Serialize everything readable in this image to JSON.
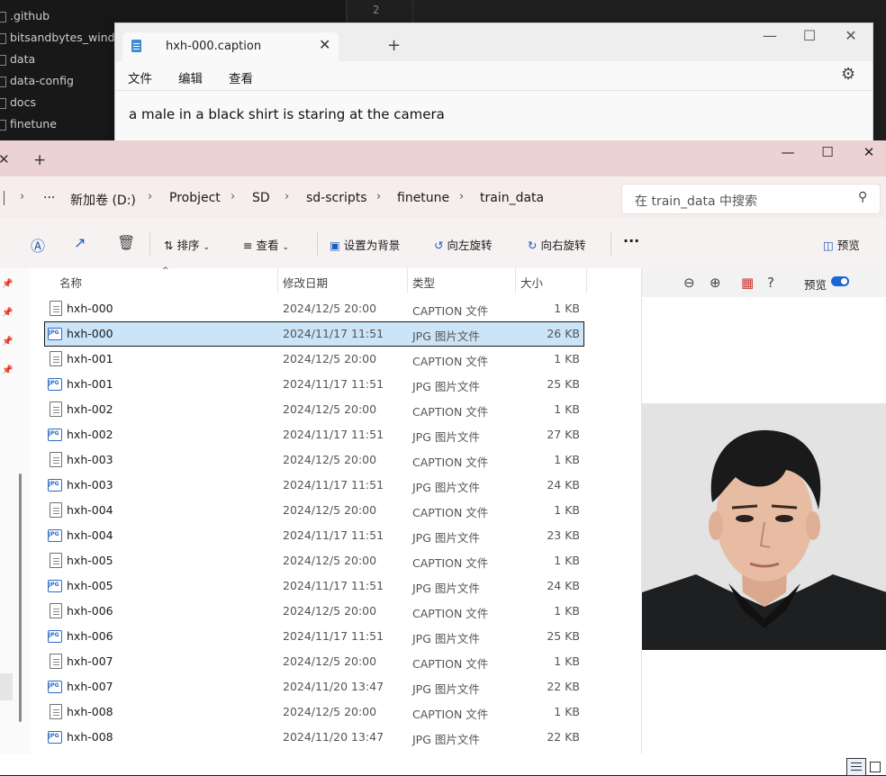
{
  "vscode": {
    "explorer_items": [
      ".github",
      "bitsandbytes_windows",
      "data",
      "data-config",
      "docs",
      "finetune"
    ],
    "line_number": "2"
  },
  "notepad": {
    "tab_title": "hxh-000.caption",
    "new_tab": "+",
    "close_tab": "✕",
    "menu": [
      "文件",
      "编辑",
      "查看"
    ],
    "content": "a male in a black shirt is staring at the camera"
  },
  "explorer": {
    "tab_close": "✕",
    "new_tab": "+",
    "breadcrumb": [
      "新加卷 (D:)",
      "Probject",
      "SD",
      "sd-scripts",
      "finetune",
      "train_data"
    ],
    "more": "···",
    "search_placeholder": "在 train_data 中搜索",
    "toolbar": {
      "sort": "排序",
      "view": "查看",
      "set_background": "设置为背景",
      "rotate_left": "向左旋转",
      "rotate_right": "向右旋转",
      "more": "···",
      "preview": "预览"
    },
    "columns": {
      "name": "名称",
      "modified": "修改日期",
      "type": "类型",
      "size": "大小"
    },
    "files": [
      {
        "name": "hxh-000",
        "date": "2024/12/5 20:00",
        "type": "CAPTION 文件",
        "size": "1 KB",
        "icon": "text-file-icon"
      },
      {
        "name": "hxh-000",
        "date": "2024/11/17 11:51",
        "type": "JPG 图片文件",
        "size": "26 KB",
        "icon": "jpg-file-icon",
        "selected": true
      },
      {
        "name": "hxh-001",
        "date": "2024/12/5 20:00",
        "type": "CAPTION 文件",
        "size": "1 KB",
        "icon": "text-file-icon"
      },
      {
        "name": "hxh-001",
        "date": "2024/11/17 11:51",
        "type": "JPG 图片文件",
        "size": "25 KB",
        "icon": "jpg-file-icon"
      },
      {
        "name": "hxh-002",
        "date": "2024/12/5 20:00",
        "type": "CAPTION 文件",
        "size": "1 KB",
        "icon": "text-file-icon"
      },
      {
        "name": "hxh-002",
        "date": "2024/11/17 11:51",
        "type": "JPG 图片文件",
        "size": "27 KB",
        "icon": "jpg-file-icon"
      },
      {
        "name": "hxh-003",
        "date": "2024/12/5 20:00",
        "type": "CAPTION 文件",
        "size": "1 KB",
        "icon": "text-file-icon"
      },
      {
        "name": "hxh-003",
        "date": "2024/11/17 11:51",
        "type": "JPG 图片文件",
        "size": "24 KB",
        "icon": "jpg-file-icon"
      },
      {
        "name": "hxh-004",
        "date": "2024/12/5 20:00",
        "type": "CAPTION 文件",
        "size": "1 KB",
        "icon": "text-file-icon"
      },
      {
        "name": "hxh-004",
        "date": "2024/11/17 11:51",
        "type": "JPG 图片文件",
        "size": "23 KB",
        "icon": "jpg-file-icon"
      },
      {
        "name": "hxh-005",
        "date": "2024/12/5 20:00",
        "type": "CAPTION 文件",
        "size": "1 KB",
        "icon": "text-file-icon"
      },
      {
        "name": "hxh-005",
        "date": "2024/11/17 11:51",
        "type": "JPG 图片文件",
        "size": "24 KB",
        "icon": "jpg-file-icon"
      },
      {
        "name": "hxh-006",
        "date": "2024/12/5 20:00",
        "type": "CAPTION 文件",
        "size": "1 KB",
        "icon": "text-file-icon"
      },
      {
        "name": "hxh-006",
        "date": "2024/11/17 11:51",
        "type": "JPG 图片文件",
        "size": "25 KB",
        "icon": "jpg-file-icon"
      },
      {
        "name": "hxh-007",
        "date": "2024/12/5 20:00",
        "type": "CAPTION 文件",
        "size": "1 KB",
        "icon": "text-file-icon"
      },
      {
        "name": "hxh-007",
        "date": "2024/11/20 13:47",
        "type": "JPG 图片文件",
        "size": "22 KB",
        "icon": "jpg-file-icon"
      },
      {
        "name": "hxh-008",
        "date": "2024/12/5 20:00",
        "type": "CAPTION 文件",
        "size": "1 KB",
        "icon": "text-file-icon"
      },
      {
        "name": "hxh-008",
        "date": "2024/11/20 13:47",
        "type": "JPG 图片文件",
        "size": "22 KB",
        "icon": "jpg-file-icon"
      }
    ],
    "preview_pane": {
      "label": "预览",
      "toggle_on": true
    }
  },
  "colors": {
    "accent": "#1a66d6",
    "selection": "#cce4f7",
    "explorer_titlebar": "#ecd2d2"
  }
}
